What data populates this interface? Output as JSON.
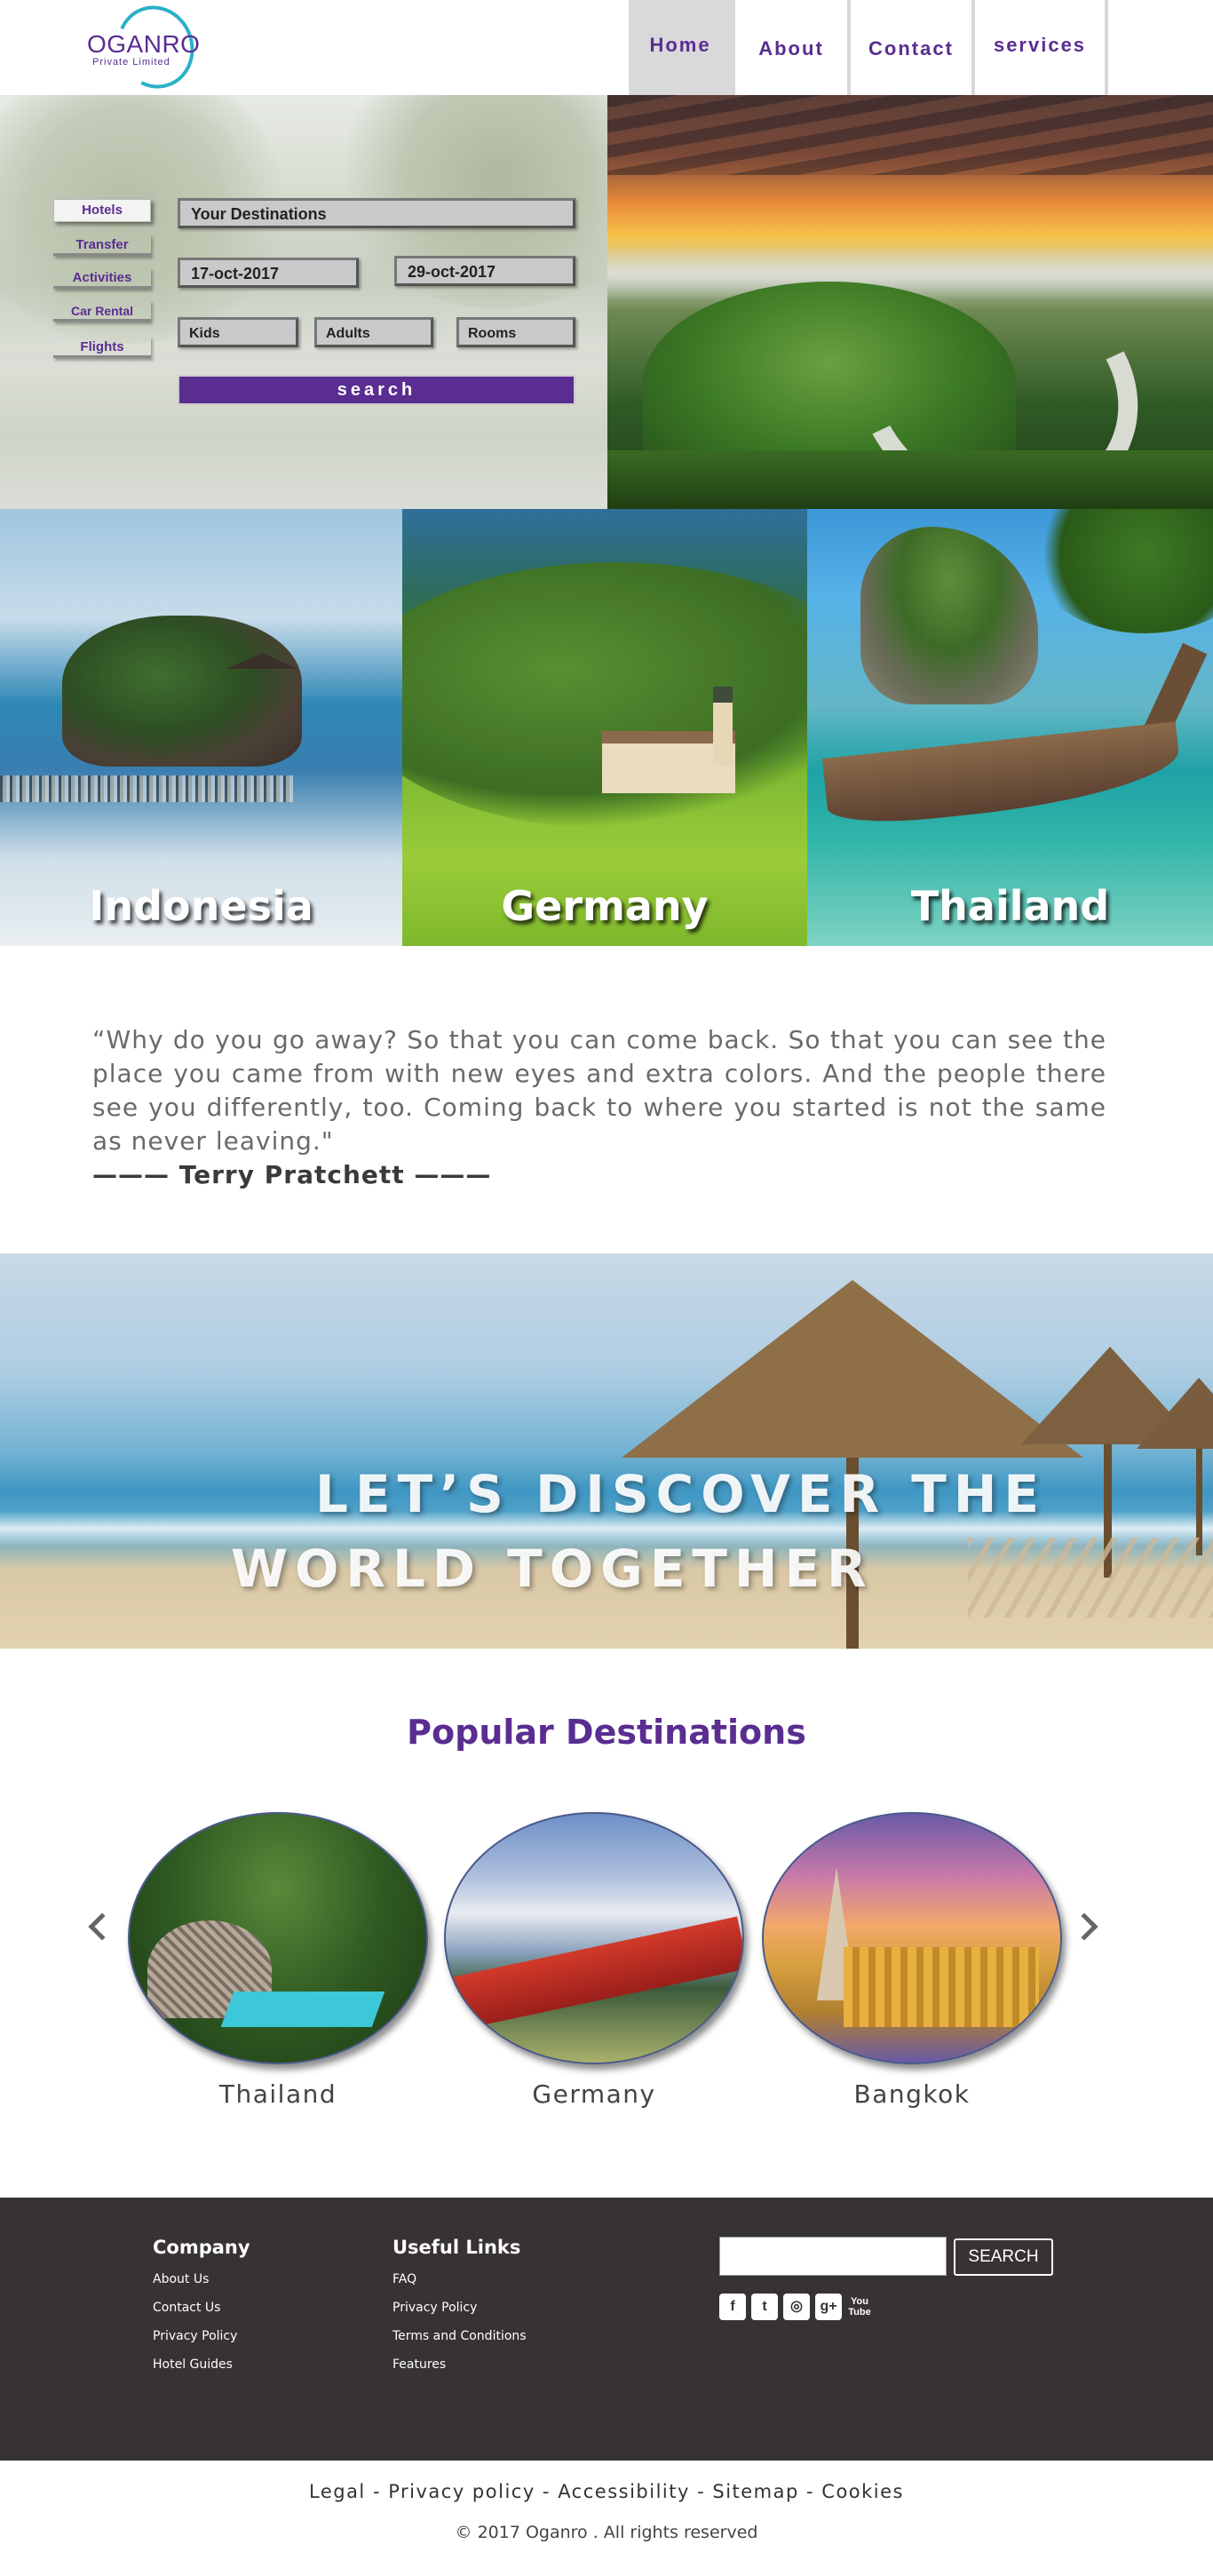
{
  "brand": {
    "name": "OGANRO",
    "tagline": "Private Limited",
    "accent": "#5a2d91"
  },
  "nav": {
    "items": [
      "Home",
      "About",
      "Contact",
      "services"
    ],
    "active": "Home"
  },
  "booking": {
    "tabs": [
      "Hotels",
      "Transfer",
      "Activities",
      "Car Rental",
      "Flights"
    ],
    "destination_placeholder": "Your Destinations",
    "check_in": "17-oct-2017",
    "check_out": "29-oct-2017",
    "kids": "Kids",
    "adults": "Adults",
    "rooms": "Rooms",
    "search_label": "search"
  },
  "destinations": [
    {
      "name": "Indonesia"
    },
    {
      "name": "Germany"
    },
    {
      "name": "Thailand"
    }
  ],
  "quote": {
    "text": "“Why do you go away? So that you can come back. So that you can see the place you came from with new eyes and extra colors. And the people there see you differently, too. Coming back to where you started is not the same as never leaving.\"",
    "author": "——— Terry Pratchett ———"
  },
  "banner": {
    "line1": "LET’S DISCOVER THE",
    "line2": "WORLD TOGETHER"
  },
  "popular": {
    "title": "Popular Destinations",
    "items": [
      {
        "name": "Thailand"
      },
      {
        "name": "Germany"
      },
      {
        "name": "Bangkok"
      }
    ],
    "prev_icon": "chevron-left-icon",
    "next_icon": "chevron-right-icon"
  },
  "footer": {
    "company": {
      "title": "Company",
      "links": [
        "About Us",
        "Contact Us",
        "Privacy Policy",
        "Hotel Guides"
      ]
    },
    "useful": {
      "title": "Useful Links",
      "links": [
        "FAQ",
        "Privacy Policy",
        "Terms and Conditions",
        "Features"
      ]
    },
    "search_button": "SEARCH",
    "socials": [
      {
        "icon": "facebook-icon",
        "glyph": "f"
      },
      {
        "icon": "twitter-icon",
        "glyph": "t"
      },
      {
        "icon": "instagram-icon",
        "glyph": "◎"
      },
      {
        "icon": "google-plus-icon",
        "glyph": "g+"
      },
      {
        "icon": "youtube-icon",
        "glyph": "You Tube"
      }
    ],
    "background": "#373234"
  },
  "bottom": {
    "links": [
      "Legal",
      "Privacy policy",
      "Accessibility",
      "Sitemap",
      "Cookies"
    ],
    "separator": " - ",
    "copyright": "© 2017 Oganro . All rights reserved"
  }
}
